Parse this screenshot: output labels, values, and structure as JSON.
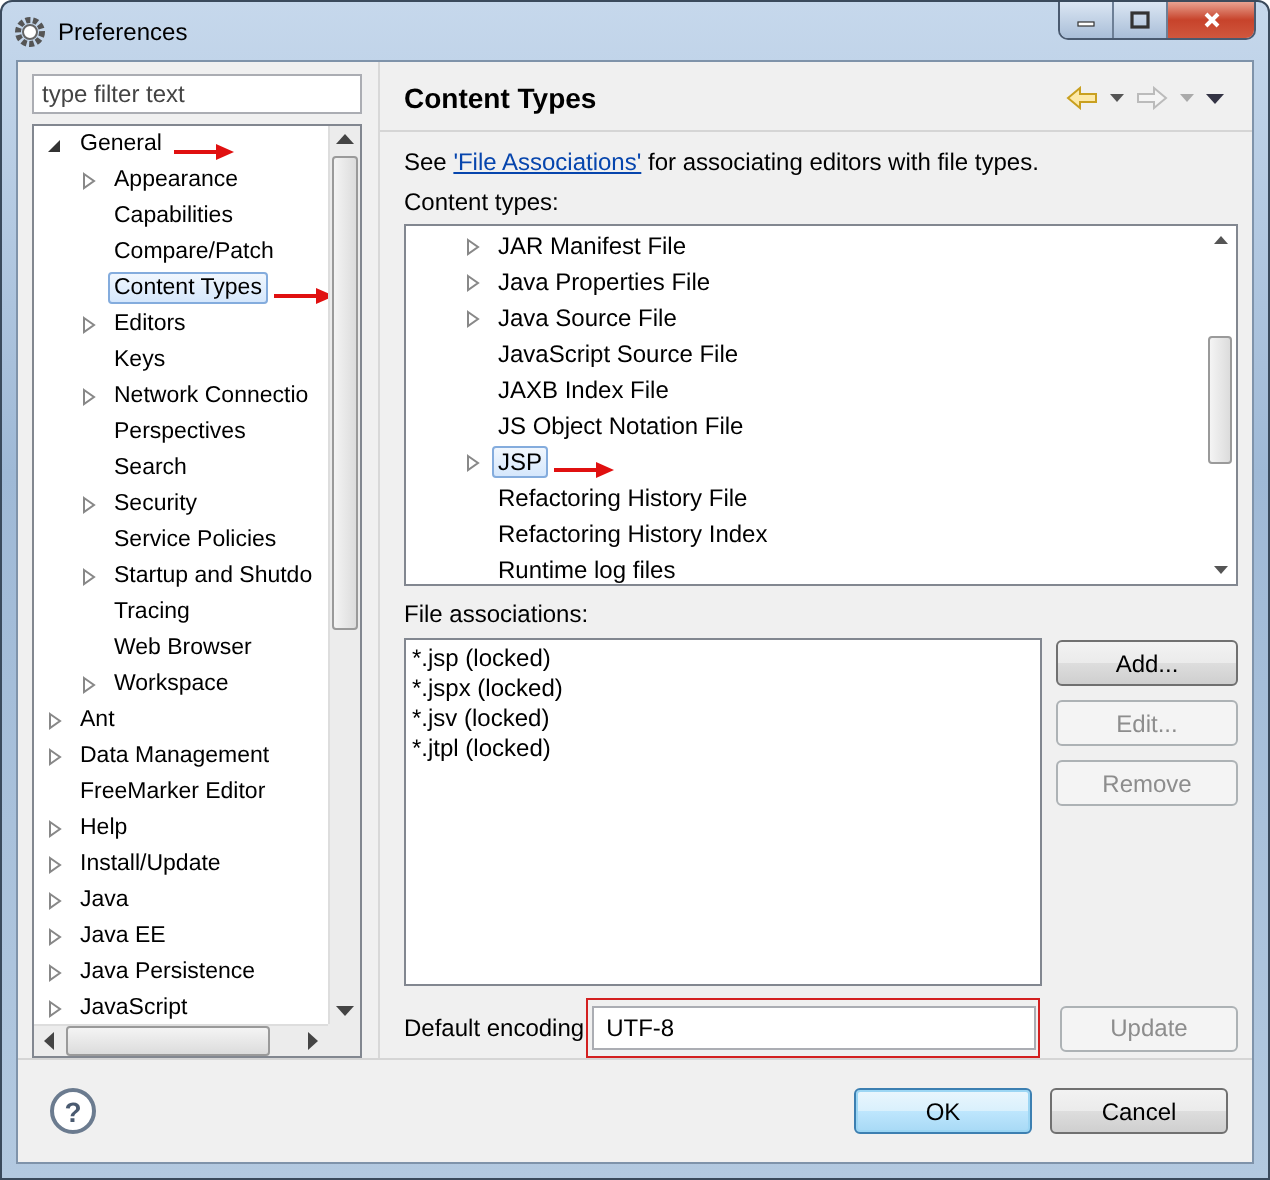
{
  "window": {
    "title": "Preferences"
  },
  "sidebar": {
    "filter": {
      "placeholder": "type filter text"
    },
    "tree": [
      {
        "label": "General",
        "kind": "branch",
        "expanded": true,
        "selected": false,
        "marked": true,
        "children": [
          {
            "label": "Appearance",
            "kind": "branch",
            "expanded": false,
            "selected": false,
            "marked": false
          },
          {
            "label": "Capabilities",
            "kind": "leaf",
            "selected": false,
            "marked": false
          },
          {
            "label": "Compare/Patch",
            "kind": "leaf",
            "selected": false,
            "marked": false
          },
          {
            "label": "Content Types",
            "kind": "leaf",
            "selected": true,
            "marked": true
          },
          {
            "label": "Editors",
            "kind": "branch",
            "expanded": false,
            "selected": false,
            "marked": false
          },
          {
            "label": "Keys",
            "kind": "leaf",
            "selected": false,
            "marked": false
          },
          {
            "label": "Network Connectio",
            "kind": "branch",
            "expanded": false,
            "selected": false,
            "marked": false
          },
          {
            "label": "Perspectives",
            "kind": "leaf",
            "selected": false,
            "marked": false
          },
          {
            "label": "Search",
            "kind": "leaf",
            "selected": false,
            "marked": false
          },
          {
            "label": "Security",
            "kind": "branch",
            "expanded": false,
            "selected": false,
            "marked": false
          },
          {
            "label": "Service Policies",
            "kind": "leaf",
            "selected": false,
            "marked": false
          },
          {
            "label": "Startup and Shutdo",
            "kind": "branch",
            "expanded": false,
            "selected": false,
            "marked": false
          },
          {
            "label": "Tracing",
            "kind": "leaf",
            "selected": false,
            "marked": false
          },
          {
            "label": "Web Browser",
            "kind": "leaf",
            "selected": false,
            "marked": false
          },
          {
            "label": "Workspace",
            "kind": "branch",
            "expanded": false,
            "selected": false,
            "marked": false
          }
        ]
      },
      {
        "label": "Ant",
        "kind": "branch",
        "expanded": false,
        "selected": false,
        "marked": false
      },
      {
        "label": "Data Management",
        "kind": "branch",
        "expanded": false,
        "selected": false,
        "marked": false
      },
      {
        "label": "FreeMarker Editor",
        "kind": "leaf",
        "selected": false,
        "marked": false
      },
      {
        "label": "Help",
        "kind": "branch",
        "expanded": false,
        "selected": false,
        "marked": false
      },
      {
        "label": "Install/Update",
        "kind": "branch",
        "expanded": false,
        "selected": false,
        "marked": false
      },
      {
        "label": "Java",
        "kind": "branch",
        "expanded": false,
        "selected": false,
        "marked": false
      },
      {
        "label": "Java EE",
        "kind": "branch",
        "expanded": false,
        "selected": false,
        "marked": false
      },
      {
        "label": "Java Persistence",
        "kind": "branch",
        "expanded": false,
        "selected": false,
        "marked": false
      },
      {
        "label": "JavaScript",
        "kind": "branch",
        "expanded": false,
        "selected": false,
        "marked": false
      }
    ]
  },
  "page": {
    "title": "Content Types",
    "intro": {
      "before": "See ",
      "link": "'File Associations'",
      "after": " for associating editors with file types."
    },
    "content_types_label": "Content types:",
    "content_types": [
      {
        "label": "JAR Manifest File",
        "kind": "branch",
        "expanded": false,
        "selected": false,
        "marked": false
      },
      {
        "label": "Java Properties File",
        "kind": "branch",
        "expanded": false,
        "selected": false,
        "marked": false
      },
      {
        "label": "Java Source File",
        "kind": "branch",
        "expanded": false,
        "selected": false,
        "marked": false
      },
      {
        "label": "JavaScript Source File",
        "kind": "leaf",
        "selected": false,
        "marked": false
      },
      {
        "label": "JAXB Index File",
        "kind": "leaf",
        "selected": false,
        "marked": false
      },
      {
        "label": "JS Object Notation File",
        "kind": "leaf",
        "selected": false,
        "marked": false
      },
      {
        "label": "JSP",
        "kind": "branch",
        "expanded": false,
        "selected": true,
        "marked": true
      },
      {
        "label": "Refactoring History File",
        "kind": "leaf",
        "selected": false,
        "marked": false
      },
      {
        "label": "Refactoring History Index",
        "kind": "leaf",
        "selected": false,
        "marked": false
      },
      {
        "label": "Runtime log files",
        "kind": "leaf",
        "selected": false,
        "marked": false
      }
    ],
    "file_associations_label": "File associations:",
    "file_associations": [
      "*.jsp (locked)",
      "*.jspx (locked)",
      "*.jsv (locked)",
      "*.jtpl (locked)"
    ],
    "association_buttons": [
      {
        "label": "Add...",
        "disabled": false
      },
      {
        "label": "Edit...",
        "disabled": true
      },
      {
        "label": "Remove",
        "disabled": true
      }
    ],
    "encoding": {
      "label": "Default encoding",
      "value": "UTF-8",
      "marked": true
    },
    "update_button": {
      "label": "Update",
      "disabled": true
    }
  },
  "help": {
    "glyph": "?"
  },
  "buttons": [
    {
      "label": "OK",
      "default": true
    },
    {
      "label": "Cancel",
      "default": false
    }
  ]
}
